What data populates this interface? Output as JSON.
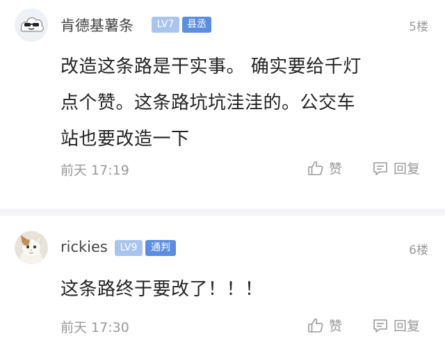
{
  "comments": [
    {
      "username": "肯德基薯条",
      "level": "LV7",
      "title": "县丞",
      "floor": "5楼",
      "lines": [
        "改造这条路是干实事。 确实要给千灯",
        "点个赞。这条路坑坑洼洼的。公交车",
        "站也要改造一下"
      ],
      "time": "前天 17:19",
      "like_label": "赞",
      "reply_label": "回复"
    },
    {
      "username": "rickies",
      "level": "LV9",
      "title": "通判",
      "floor": "6楼",
      "lines": [
        "这条路终于要改了！！！"
      ],
      "time": "前天 17:30",
      "like_label": "赞",
      "reply_label": "回复"
    }
  ],
  "colors": {
    "level_badge": "#a9c4ee",
    "title_badge": "#5b8ee0",
    "meta_text": "#999999",
    "separator": "#f5f5f7"
  },
  "icons": {
    "like": "thumbs-up-icon",
    "reply": "comment-icon"
  }
}
